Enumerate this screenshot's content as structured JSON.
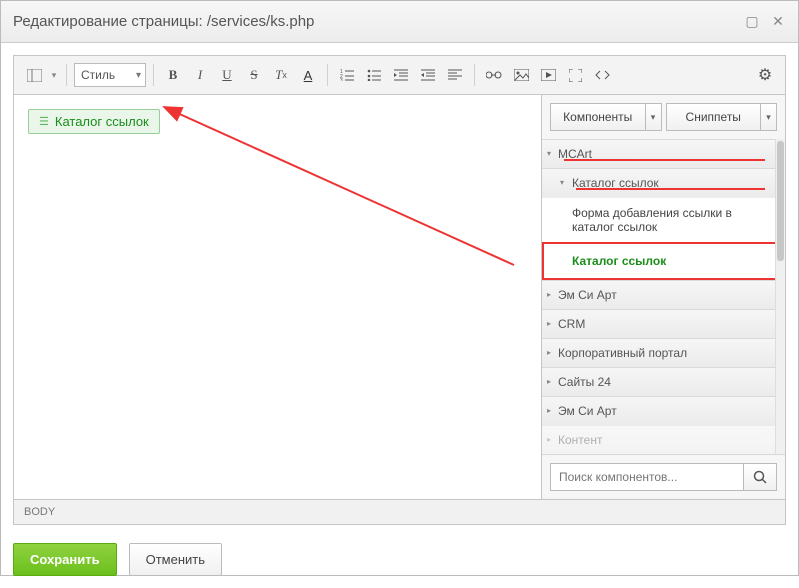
{
  "window": {
    "title": "Редактирование страницы: /services/ks.php"
  },
  "toolbar": {
    "style_label": "Стиль"
  },
  "canvas": {
    "widget_label": "Каталог ссылок"
  },
  "sidepanel": {
    "tab_components": "Компоненты",
    "tab_snippets": "Сниппеты",
    "search_placeholder": "Поиск компонентов...",
    "tree": [
      {
        "type": "node",
        "level": 0,
        "label": "MCArt",
        "expanded": true
      },
      {
        "type": "node",
        "level": 1,
        "label": "Каталог ссылок",
        "expanded": true
      },
      {
        "type": "leaf",
        "label": "Форма добавления ссылки в каталог ссылок",
        "active": false
      },
      {
        "type": "leaf",
        "label": "Каталог ссылок",
        "active": true
      },
      {
        "type": "node",
        "level": 0,
        "label": "Эм Си Арт",
        "expanded": false
      },
      {
        "type": "node",
        "level": 0,
        "label": "CRM",
        "expanded": false
      },
      {
        "type": "node",
        "level": 0,
        "label": "Корпоративный портал",
        "expanded": false
      },
      {
        "type": "node",
        "level": 0,
        "label": "Сайты 24",
        "expanded": false
      },
      {
        "type": "node",
        "level": 0,
        "label": "Эм Си Арт",
        "expanded": false
      },
      {
        "type": "node",
        "level": 0,
        "label": "Контент",
        "expanded": false
      }
    ]
  },
  "statusbar": {
    "path": "BODY"
  },
  "footer": {
    "save": "Сохранить",
    "cancel": "Отменить"
  }
}
